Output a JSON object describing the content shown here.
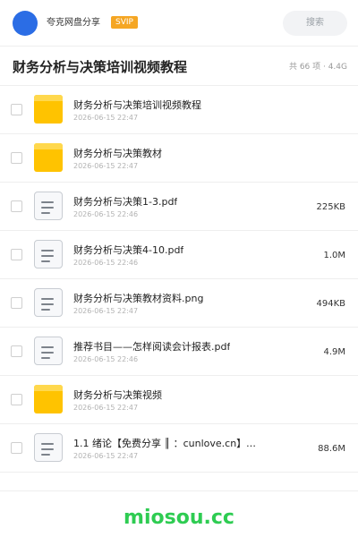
{
  "header": {
    "username": "夸克网盘分享",
    "badge": "SVIP",
    "search_label": "搜索"
  },
  "folder_title": "财务分析与决策培训视频教程",
  "folder_meta": "共 66 项 · 4.4G",
  "files": [
    {
      "name": "财务分析与决策培训视频教程",
      "date": "2026-06-15 22:47",
      "size": "",
      "icon": "folder-icon"
    },
    {
      "name": "财务分析与决策教材",
      "date": "2026-06-15 22:47",
      "size": "",
      "icon": "folder-icon"
    },
    {
      "name": "财务分析与决策1-3.pdf",
      "date": "2026-06-15 22:46",
      "size": "225KB",
      "icon": "document-icon"
    },
    {
      "name": "财务分析与决策4-10.pdf",
      "date": "2026-06-15 22:46",
      "size": "1.0M",
      "icon": "document-icon"
    },
    {
      "name": "财务分析与决策教材资料.png",
      "date": "2026-06-15 22:47",
      "size": "494KB",
      "icon": "document-icon"
    },
    {
      "name": "推荐书目——怎样阅读会计报表.pdf",
      "date": "2026-06-15 22:46",
      "size": "4.9M",
      "icon": "document-icon"
    },
    {
      "name": "财务分析与决策视频",
      "date": "2026-06-15 22:47",
      "size": "",
      "icon": "folder-icon"
    },
    {
      "name": "1.1 绪论【免费分享 ║ ：cunlove.cn】.…",
      "date": "2026-06-15 22:47",
      "size": "88.6M",
      "icon": "document-icon"
    }
  ],
  "footer": {
    "brand": "miosou.cc"
  },
  "colors": {
    "avatar": "#2b6de5",
    "badge": "#f5a623",
    "folder": "#ffc300",
    "brand": "#2ecc52"
  }
}
